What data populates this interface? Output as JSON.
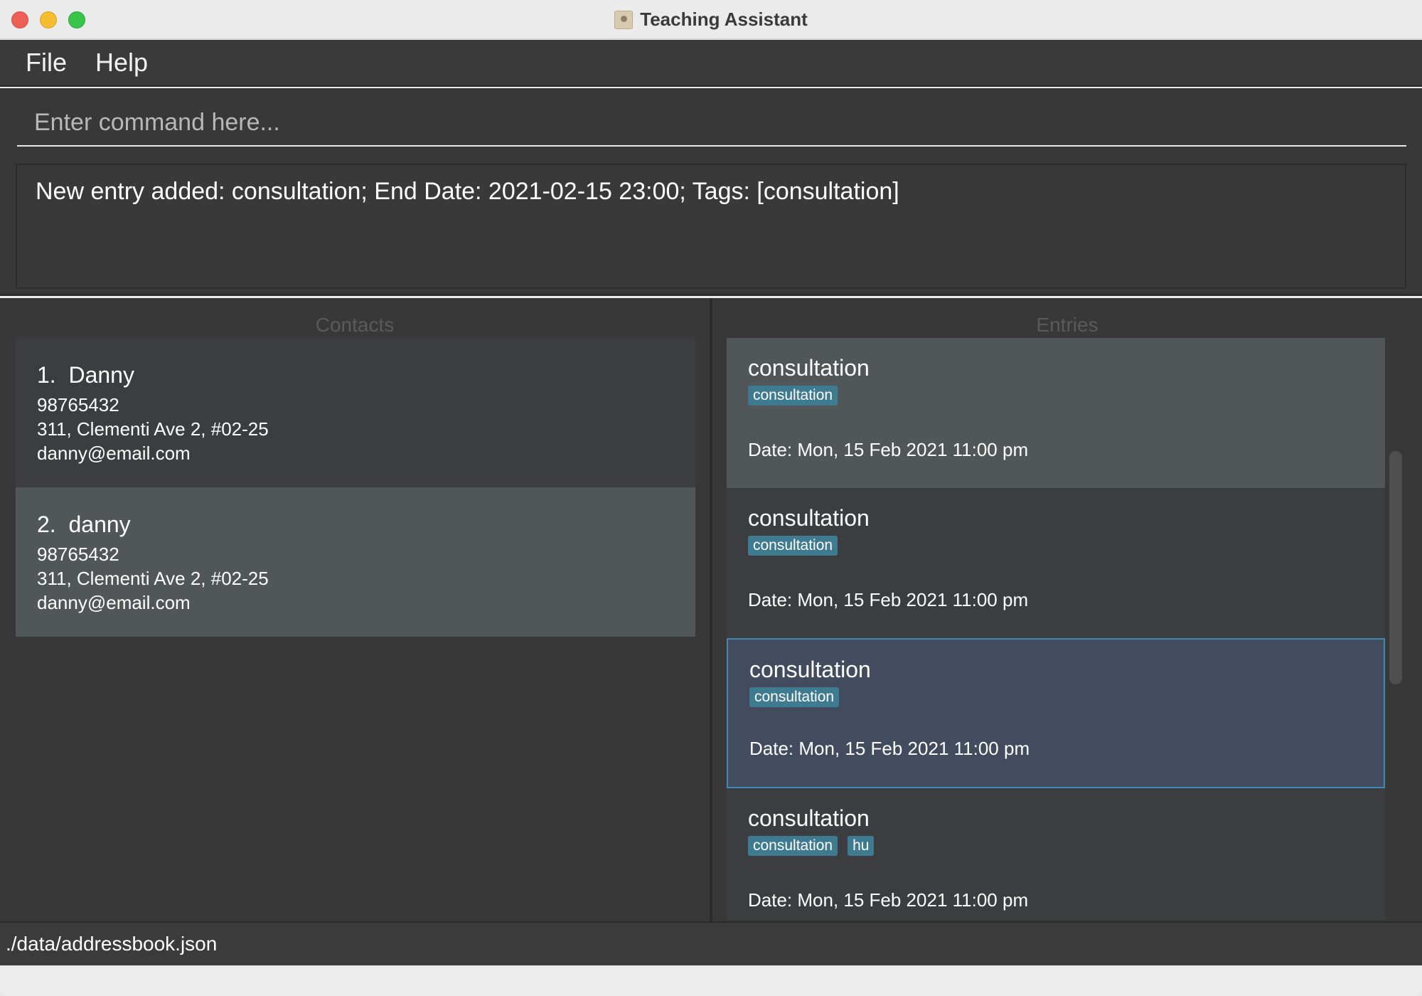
{
  "window": {
    "title": "Teaching Assistant"
  },
  "menu": {
    "items": [
      {
        "label": "File"
      },
      {
        "label": "Help"
      }
    ]
  },
  "command": {
    "placeholder": "Enter command here...",
    "value": ""
  },
  "result": {
    "text": "New entry added: consultation; End Date: 2021-02-15 23:00; Tags: [consultation]"
  },
  "contacts": {
    "title": "Contacts",
    "items": [
      {
        "index": "1.",
        "name": "Danny",
        "phone": "98765432",
        "address": "311, Clementi Ave 2, #02-25",
        "email": "danny@email.com"
      },
      {
        "index": "2.",
        "name": "danny",
        "phone": "98765432",
        "address": "311, Clementi Ave 2, #02-25",
        "email": "danny@email.com"
      }
    ]
  },
  "entries": {
    "title": "Entries",
    "items": [
      {
        "name": "consultation",
        "tags": [
          "consultation"
        ],
        "date": "Date: Mon, 15 Feb 2021 11:00 pm"
      },
      {
        "name": "consultation",
        "tags": [
          "consultation"
        ],
        "date": "Date: Mon, 15 Feb 2021 11:00 pm"
      },
      {
        "name": "consultation",
        "tags": [
          "consultation"
        ],
        "date": "Date: Mon, 15 Feb 2021 11:00 pm",
        "selected": true
      },
      {
        "name": "consultation",
        "tags": [
          "consultation",
          "hu"
        ],
        "date": "Date: Mon, 15 Feb 2021 11:00 pm"
      }
    ]
  },
  "status": {
    "file_path": "./data/addressbook.json"
  },
  "colors": {
    "background": "#383838",
    "tag": "#3e7b91",
    "selected_border": "#3e8ab3",
    "selected_bg": "#434c5e"
  }
}
